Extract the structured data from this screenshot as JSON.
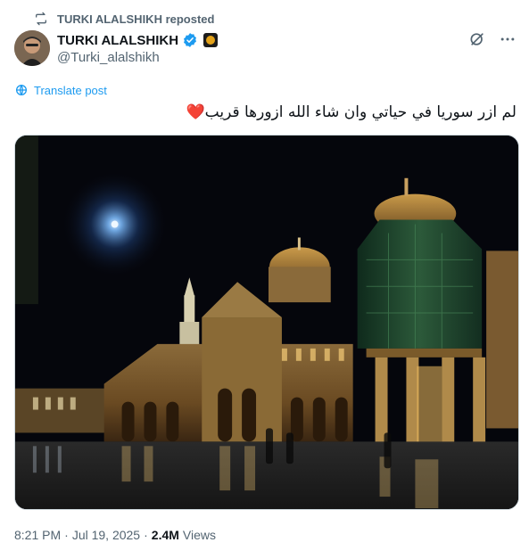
{
  "repost": {
    "label": "TURKI ALALSHIKH reposted",
    "icon": "repost-icon"
  },
  "author": {
    "display_name": "TURKI ALALSHIKH",
    "handle": "@Turki_alalshikh",
    "verified_icon": "verified-badge-icon",
    "affiliation_icon": "affiliation-badge-icon"
  },
  "actions": {
    "grok_icon": "grok-icon",
    "more_icon": "more-options-icon"
  },
  "translate": {
    "label": "Translate post",
    "icon": "translate-icon"
  },
  "tweet": {
    "text": "لم ازر سوريا في حياتي وان شاء الله ازورها قريب❤️"
  },
  "media": {
    "description_icon": "photo-umayyad-mosque-night"
  },
  "meta": {
    "time": "8:21 PM",
    "separator1": "·",
    "date": "Jul 19, 2025",
    "separator2": "·",
    "views_count": "2.4M",
    "views_label": "Views"
  },
  "colors": {
    "link": "#1d9bf0",
    "secondary": "#536471",
    "primary": "#0f1419"
  }
}
